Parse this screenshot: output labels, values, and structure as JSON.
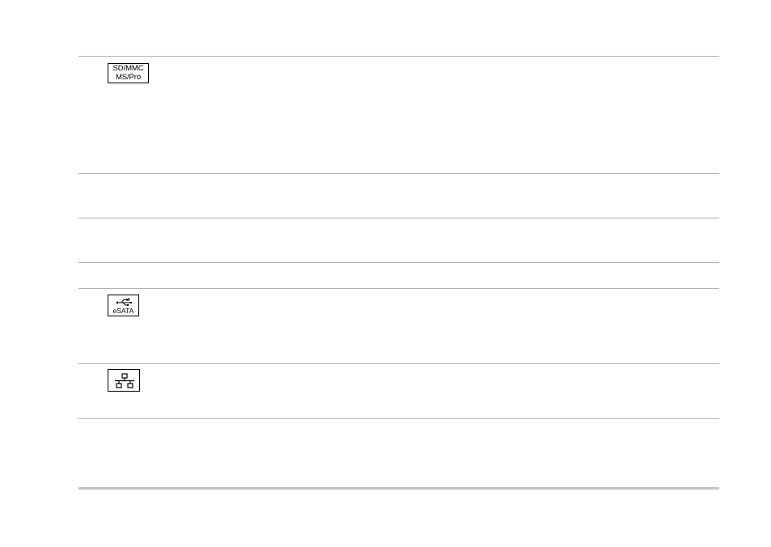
{
  "table": {
    "rows": [
      {
        "icon": "sd-mmc-ms-pro-card-reader-icon",
        "icon_label_line1": "SD/MMC",
        "icon_label_line2": "MS/Pro"
      },
      {
        "icon": ""
      },
      {
        "icon": ""
      },
      {
        "icon": ""
      },
      {
        "icon": "usb-esata-combo-icon",
        "icon_label": "eSATA"
      },
      {
        "icon": "network-icon"
      },
      {
        "icon": ""
      }
    ]
  }
}
